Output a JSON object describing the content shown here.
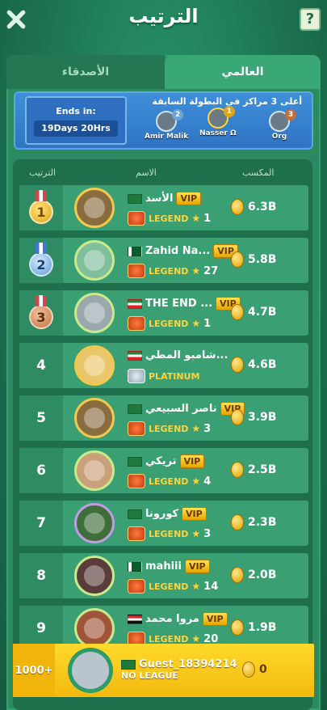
{
  "header": {
    "title": "الترتيب",
    "help_label": "?"
  },
  "tabs": {
    "friends": "الأصدقاء",
    "global": "العالمي"
  },
  "banner": {
    "ends_label": "Ends in:",
    "ends_value": "19Days 20Hrs",
    "caption": "أعلى 3 مراكز في البطولة السابقة",
    "top3": [
      {
        "name": "Amir Malik",
        "place": "2"
      },
      {
        "name": "Nasser Ω",
        "place": "1"
      },
      {
        "name": "Org",
        "place": "3"
      }
    ]
  },
  "columns": {
    "rank": "الترتيب",
    "name": "الاسم",
    "earnings": "المكسب"
  },
  "rows": [
    {
      "rank": "1",
      "name": "الأسد",
      "flag": "sa",
      "vip": "VIP",
      "league": "LEGEND",
      "level": "1",
      "coins": "6.3B"
    },
    {
      "rank": "2",
      "name": "Zahid Na...",
      "flag": "pk",
      "vip": "VIP",
      "league": "LEGEND",
      "level": "27",
      "coins": "5.8B"
    },
    {
      "rank": "3",
      "name": "THE END ...",
      "flag": "kw",
      "vip": "VIP",
      "league": "LEGEND",
      "level": "1",
      "coins": "4.7B"
    },
    {
      "rank": "4",
      "name": "شامبو المطي...",
      "flag": "kw",
      "vip": "",
      "league": "PLATINUM",
      "level": "",
      "coins": "4.6B"
    },
    {
      "rank": "5",
      "name": "ناصر السبيعي",
      "flag": "sa",
      "vip": "VIP",
      "league": "LEGEND",
      "level": "3",
      "coins": "3.9B"
    },
    {
      "rank": "6",
      "name": "تريكي",
      "flag": "sa",
      "vip": "VIP",
      "league": "LEGEND",
      "level": "4",
      "coins": "2.5B"
    },
    {
      "rank": "7",
      "name": "كورونا",
      "flag": "sa",
      "vip": "VIP",
      "league": "LEGEND",
      "level": "3",
      "coins": "2.3B"
    },
    {
      "rank": "8",
      "name": "mahiii",
      "flag": "pk",
      "vip": "VIP",
      "league": "LEGEND",
      "level": "14",
      "coins": "2.0B"
    },
    {
      "rank": "9",
      "name": "مروا محمد",
      "flag": "eg",
      "vip": "VIP",
      "league": "LEGEND",
      "level": "20",
      "coins": "1.9B"
    }
  ],
  "me": {
    "rank": "1000+",
    "name": "Guest_18394214",
    "league": "NO LEAGUE",
    "coins": "0"
  }
}
